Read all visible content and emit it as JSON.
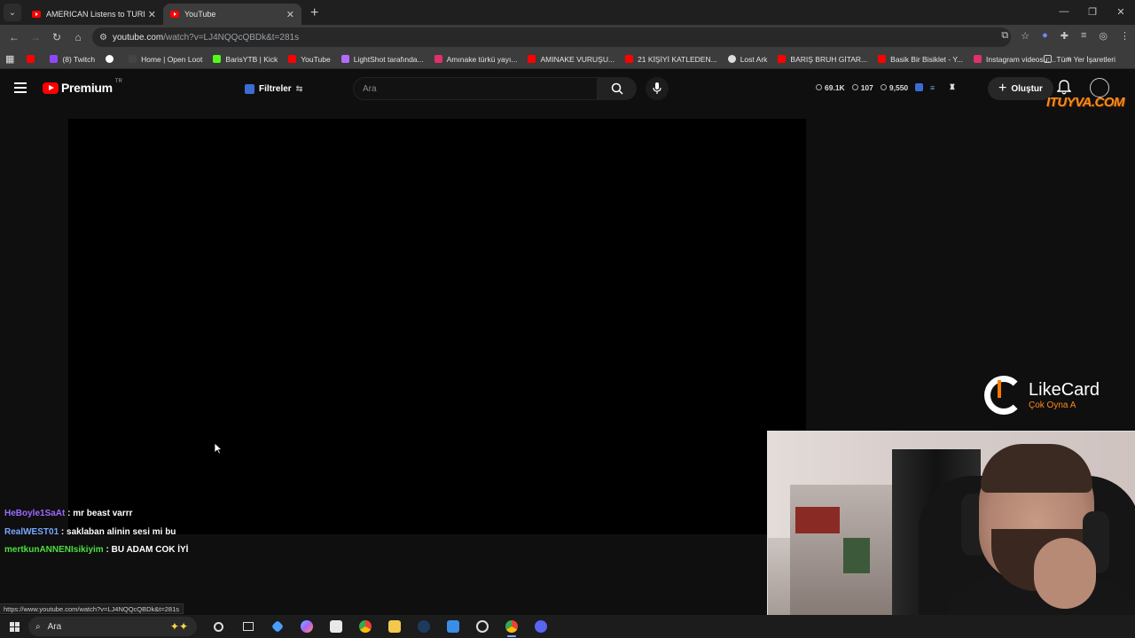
{
  "browser": {
    "tabs": [
      {
        "title": "AMERICAN Listens to TURKISH",
        "active": false
      },
      {
        "title": "YouTube",
        "active": true
      }
    ],
    "url_host": "youtube.com",
    "url_path": "/watch?v=LJ4NQQcQBDk&t=281s",
    "bookmarks": [
      {
        "label": "(8) Twitch",
        "color": "#9146ff"
      },
      {
        "label": "Home | Open Loot",
        "color": "#444444"
      },
      {
        "label": "BarisYTB | Kick",
        "color": "#53fc18"
      },
      {
        "label": "YouTube",
        "color": "#ff0000"
      },
      {
        "label": "LightShot tarafında...",
        "color": "#b36bff"
      },
      {
        "label": "Amınake türkü yayı...",
        "color": "#e1306c"
      },
      {
        "label": "AMINAKE VURUŞU...",
        "color": "#ff0000"
      },
      {
        "label": "21 KİŞİYİ KATLEDEN...",
        "color": "#ff0000"
      },
      {
        "label": "Lost Ark",
        "color": "#dddddd"
      },
      {
        "label": "BARIŞ BRUH GİTAR...",
        "color": "#ff0000"
      },
      {
        "label": "Basik Bir Bisiklet - Y...",
        "color": "#ff0000"
      },
      {
        "label": "Instagram videosu:...",
        "color": "#e1306c"
      }
    ],
    "all_bookmarks": "Tüm Yer İşaretleri",
    "status_url": "https://www.youtube.com/watch?v=LJ4NQQcQBDk&t=281s"
  },
  "youtube": {
    "logo": "Premium",
    "region": "TR",
    "filters": "Filtreler",
    "search_placeholder": "Ara",
    "stats": {
      "views": "69.1K",
      "likes": "107",
      "other": "9,550"
    },
    "create": "Oluştur"
  },
  "overlay": {
    "brand": "ITUYVA.COM",
    "likecard_name": "LikeCard",
    "likecard_slogan": "Çok Oyna  A"
  },
  "chat": [
    {
      "user": "HeBoyle1SaAt",
      "message": ": mr beast varrr",
      "color": "#9b6bff"
    },
    {
      "user": "RealWEST01",
      "message": ": saklaban alinin sesi mi bu",
      "color": "#78a8ff"
    },
    {
      "user": "mertkunANNENIsikiyim",
      "message": ": BU ADAM COK İYİ",
      "color": "#4cdf3f"
    }
  ],
  "taskbar": {
    "search_label": "Ara"
  }
}
